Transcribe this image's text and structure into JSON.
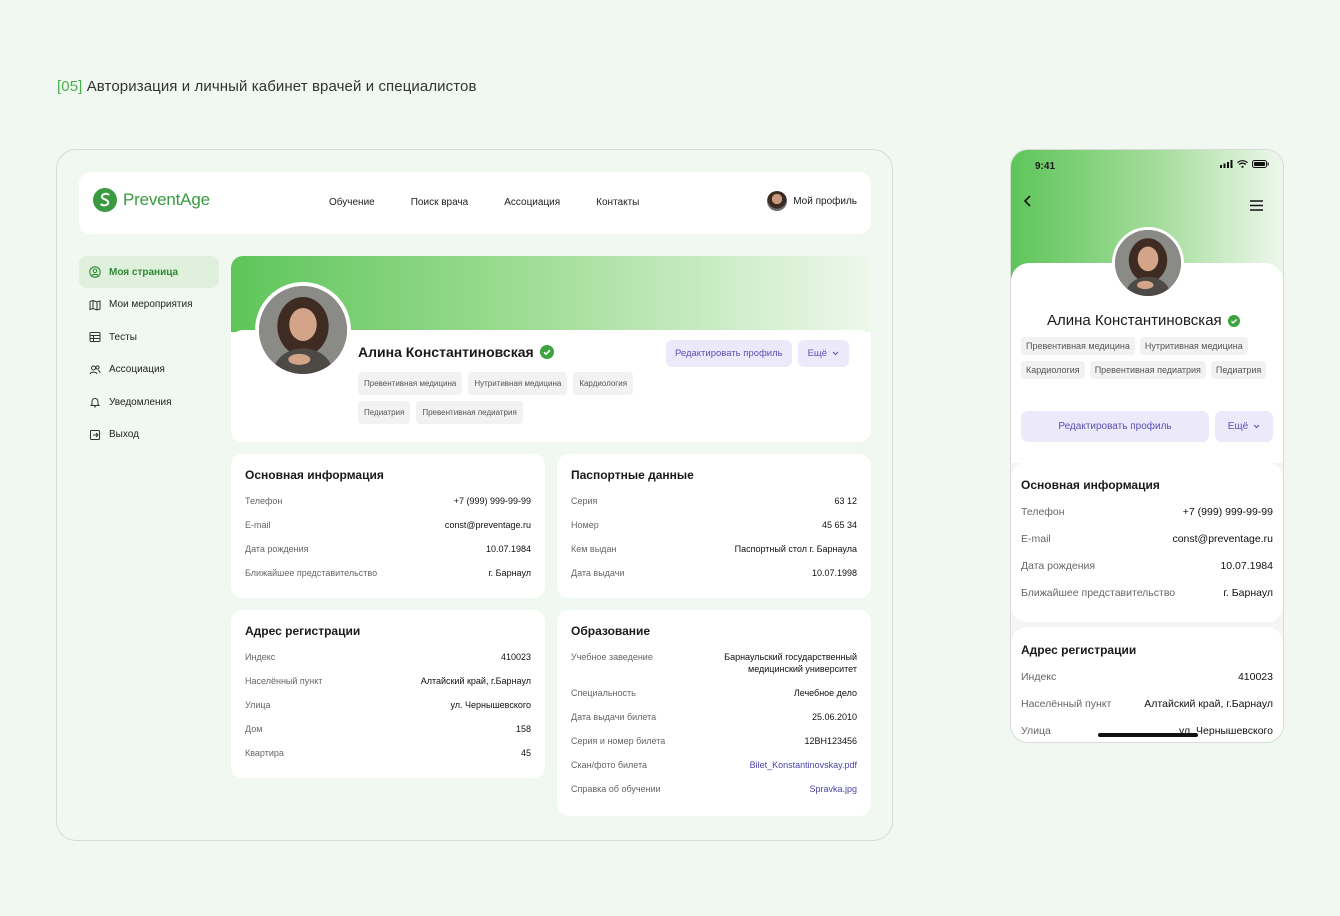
{
  "page": {
    "num": "[05]",
    "title": "Авторизация и личный кабинет врачей и специалистов"
  },
  "colors": {
    "accent": "#4caf50",
    "button": "#ece9fb",
    "button_text": "#5b50b8"
  },
  "topbar": {
    "logo": "PreventAge",
    "nav": [
      "Обучение",
      "Поиск врача",
      "Ассоциация",
      "Контакты"
    ],
    "profile": "Мой профиль"
  },
  "sidebar": {
    "items": [
      {
        "label": "Моя страница",
        "icon": "user-circle-icon",
        "active": true
      },
      {
        "label": "Мои мероприятия",
        "icon": "map-icon"
      },
      {
        "label": "Тесты",
        "icon": "table-icon"
      },
      {
        "label": "Ассоциация",
        "icon": "users-icon"
      },
      {
        "label": "Уведомления",
        "icon": "bell-icon"
      },
      {
        "label": "Выход",
        "icon": "logout-icon"
      }
    ]
  },
  "profile": {
    "name": "Алина Константиновская",
    "tags": [
      "Превентивная медицина",
      "Нутритивная медицина",
      "Кардиология",
      "Педиатрия",
      "Превентивная педиатрия"
    ],
    "edit_label": "Редактировать профиль",
    "more_label": "Ещё"
  },
  "basic": {
    "title": "Основная информация",
    "rows": [
      {
        "k": "Телефон",
        "v": "+7 (999) 999-99-99"
      },
      {
        "k": "E-mail",
        "v": "const@preventage.ru"
      },
      {
        "k": "Дата рождения",
        "v": "10.07.1984"
      },
      {
        "k": "Ближайшее представительство",
        "v": "г. Барнаул"
      }
    ]
  },
  "passport": {
    "title": "Паспортные данные",
    "rows": [
      {
        "k": "Серия",
        "v": "63 12"
      },
      {
        "k": "Номер",
        "v": "45 65 34"
      },
      {
        "k": "Кем выдан",
        "v": "Паспортный стол г. Барнаула"
      },
      {
        "k": "Дата выдачи",
        "v": "10.07.1998"
      }
    ]
  },
  "address": {
    "title": "Адрес регистрации",
    "rows": [
      {
        "k": "Индекс",
        "v": "410023"
      },
      {
        "k": "Населённый пункт",
        "v": "Алтайский край, г.Барнаул"
      },
      {
        "k": "Улица",
        "v": "ул. Чернышевского"
      },
      {
        "k": "Дом",
        "v": "158"
      },
      {
        "k": "Квартира",
        "v": "45"
      }
    ]
  },
  "education": {
    "title": "Образование",
    "rows": [
      {
        "k": "Учебное заведение",
        "v": "Барнаульский государственный медицинский университет"
      },
      {
        "k": "Специальность",
        "v": "Лечебное дело"
      },
      {
        "k": "Дата выдачи билета",
        "v": "25.06.2010"
      },
      {
        "k": "Серия и номер билета",
        "v": "12ВН123456"
      },
      {
        "k": "Скан/фото билета",
        "v": "Bilet_Konstantinovskay.pdf"
      },
      {
        "k": "Справка об обучении",
        "v": "Spravka.jpg"
      }
    ]
  },
  "mobile": {
    "time": "9:41",
    "street_value": "ул. Чернышевского"
  }
}
